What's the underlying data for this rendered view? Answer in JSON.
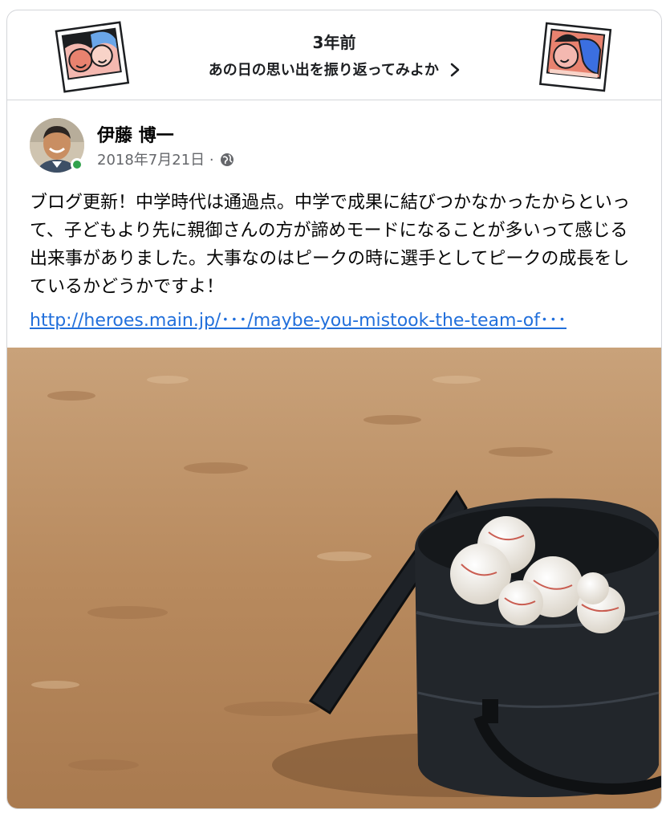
{
  "memory": {
    "title": "3年前",
    "subtitle": "あの日の思い出を振り返ってみよか"
  },
  "post": {
    "author": "伊藤 博一",
    "date": "2018年7月21日",
    "separator": "·",
    "text": "ブログ更新！中学時代は通過点。中学で成果に結びつかなかったからといって、子どもより先に親御さんの方が諦めモードになることが多いって感じる出来事がありました。大事なのはピークの時に選手としてピークの成長をしているかどうかですよ！",
    "link": "http://heroes.main.jp/･･･/maybe-you-mistook-the-team-of･･･"
  },
  "icons": {
    "chevron": "chevron-right-icon",
    "privacy": "globe-icon",
    "status": "online-status-icon"
  },
  "colors": {
    "link": "#216fdb",
    "online": "#31a24c",
    "meta": "#65676b"
  }
}
